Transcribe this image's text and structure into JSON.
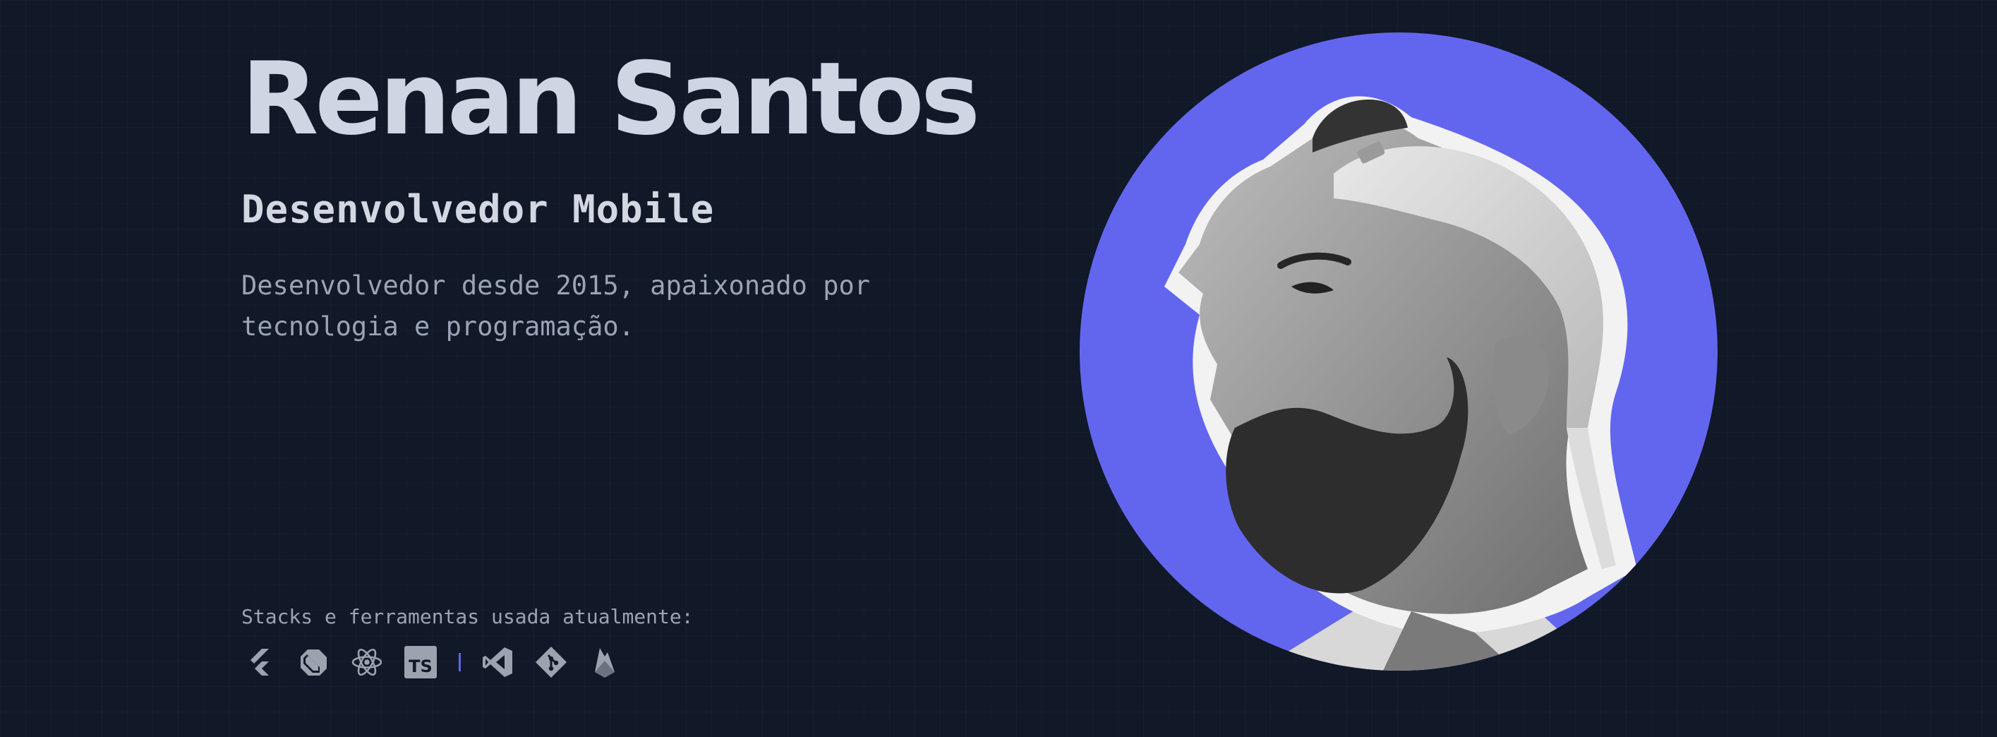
{
  "hero": {
    "name": "Renan Santos",
    "role": "Desenvolvedor Mobile",
    "bio": "Desenvolvedor desde 2015, apaixonado por tecnologia e programação."
  },
  "stacks": {
    "label": "Stacks e ferramentas usada atualmente:",
    "tools": [
      {
        "icon": "flutter-icon"
      },
      {
        "icon": "dart-icon"
      },
      {
        "icon": "react-icon"
      },
      {
        "icon": "typescript-icon",
        "text": "TS"
      },
      {
        "icon": "vscode-icon"
      },
      {
        "icon": "git-icon"
      },
      {
        "icon": "firebase-icon"
      }
    ]
  },
  "portrait": {
    "icon": "profile-photo",
    "background_color": "#6366F1"
  },
  "colors": {
    "page_background": "#111827",
    "heading": "#CFD5E2",
    "body_text": "#9BA3B6",
    "accent": "#6366F1",
    "icon": "#9CA3AF"
  }
}
